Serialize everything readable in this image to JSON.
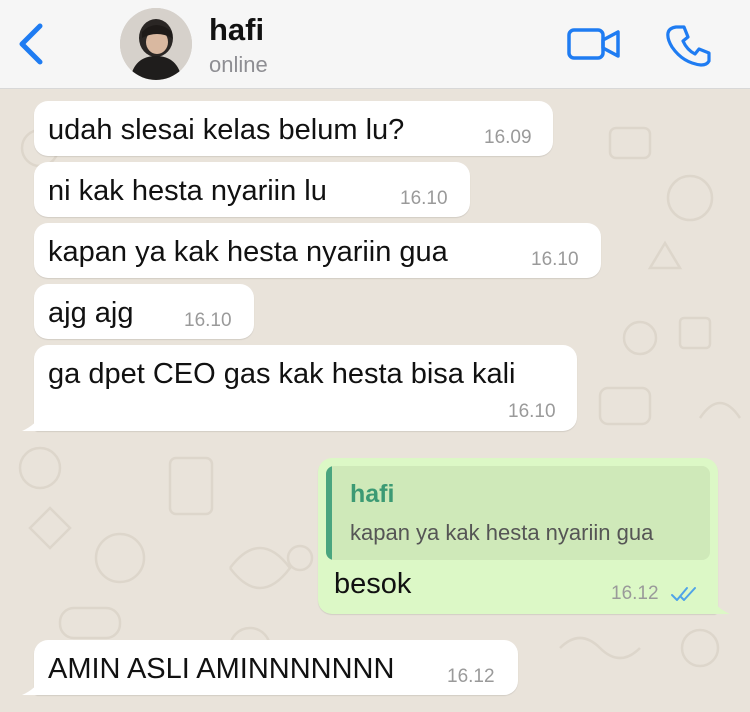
{
  "header": {
    "contact_name": "hafi",
    "status": "online"
  },
  "messages": [
    {
      "direction": "in",
      "text": "udah slesai kelas belum lu?",
      "time": "16.09"
    },
    {
      "direction": "in",
      "text": "ni kak hesta nyariin lu",
      "time": "16.10"
    },
    {
      "direction": "in",
      "text": "kapan ya kak hesta nyariin gua",
      "time": "16.10"
    },
    {
      "direction": "in",
      "text": "ajg ajg",
      "time": "16.10"
    },
    {
      "direction": "in",
      "text": "ga dpet CEO gas kak hesta bisa kali",
      "time": "16.10"
    },
    {
      "direction": "out",
      "text": "besok",
      "time": "16.12",
      "reply_to": {
        "name": "hafi",
        "text": "kapan ya kak hesta nyariin gua"
      },
      "read": true
    },
    {
      "direction": "in",
      "text": "AMIN ASLI AMINNNNNNN",
      "time": "16.12"
    }
  ],
  "colors": {
    "accent": "#1f7cf2",
    "incoming_bubble": "#ffffff",
    "outgoing_bubble": "#dcf8c6",
    "quote_name": "#3c9a74",
    "read_ticks": "#4fa3e8",
    "wallpaper": "#e9e3da"
  },
  "icons": [
    "chevron-left-icon",
    "video-call-icon",
    "phone-icon",
    "double-check-icon"
  ]
}
